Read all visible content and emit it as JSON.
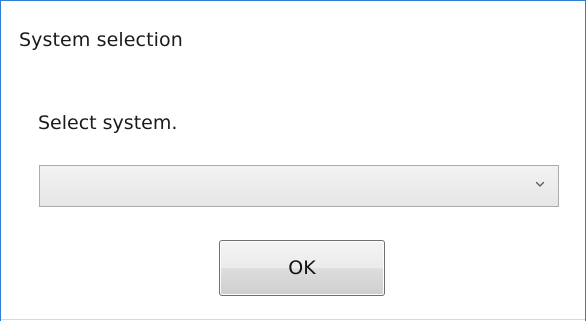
{
  "window": {
    "title": "System selection"
  },
  "content": {
    "prompt": "Select system.",
    "system_select": {
      "selected_value": "",
      "icon": "chevron-down-icon"
    },
    "ok_button": {
      "label": "OK"
    }
  },
  "colors": {
    "frame_border": "#2f7fd6",
    "text": "#1a1a1a"
  }
}
